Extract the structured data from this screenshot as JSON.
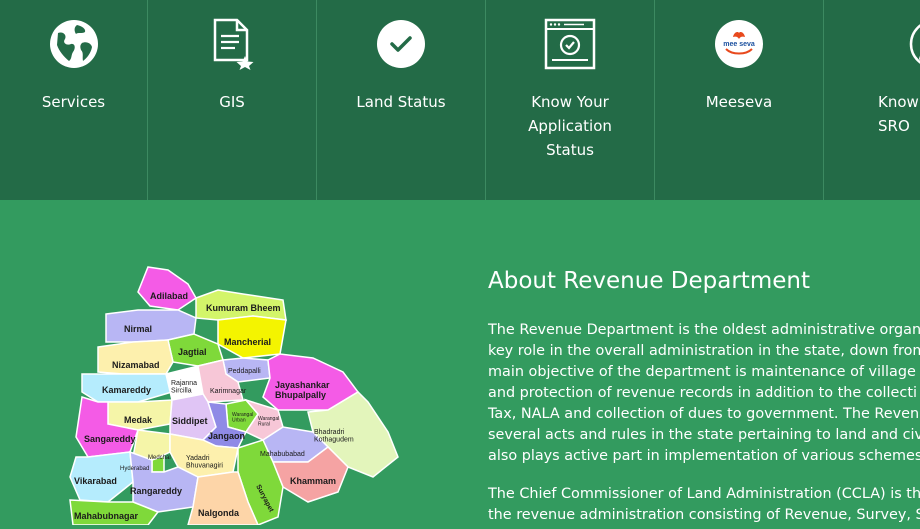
{
  "nav": {
    "items": [
      {
        "label": "Services",
        "icon": "globe-icon"
      },
      {
        "label": "GIS",
        "icon": "document-star-icon"
      },
      {
        "label": "Land Status",
        "icon": "check-circle-icon"
      },
      {
        "label": "Know Your\nApplication\nStatus",
        "icon": "browser-check-icon"
      },
      {
        "label": "Meeseva",
        "icon": "meeseva-logo"
      },
      {
        "label": "Know Y\nSRO",
        "icon": "user-circle-icon"
      }
    ]
  },
  "meeseva_logo_text": "mee seva",
  "about": {
    "title": "About Revenue Department",
    "paragraph1": [
      "The Revenue Department is the oldest administrative organ o",
      "key role in the overall administration in the state, down from",
      "main objective of the department is maintenance of village",
      "and protection of revenue records in addition to the collecti",
      "Tax, NALA and collection of dues to government. The Revenu",
      "several acts and rules in the state pertaining to land and civil",
      "also plays active part in implementation of various schemes o"
    ],
    "paragraph2": [
      "The Chief Commissioner of Land Administration (CCLA) is th",
      "the revenue administration consisting of Revenue, Survey, S"
    ]
  },
  "map": {
    "districts": {
      "adilabad": "Adilabad",
      "kumuram_bheem": "Kumuram Bheem",
      "nirmal": "Nirmal",
      "mancherial": "Mancherial",
      "jagtial": "Jagtial",
      "nizamabad": "Nizamabad",
      "peddapalli": "Peddapalli",
      "jayashankar": "Jayashankar\nBhupalpally",
      "kamareddy": "Kamareddy",
      "rajanna": "Rajanna\nSircilla",
      "karimnagar": "Karimnagar",
      "medak": "Medak",
      "siddipet": "Siddipet",
      "warangal_urban": "Warangal\nUrban",
      "warangal_rural": "Warangal\nRural",
      "bhadradri": "Bhadradri\nKothagudem",
      "sangareddy": "Sangareddy",
      "jangaon": "Jangaon",
      "mahabubabad": "Mahabubabad",
      "medchal": "Medchal",
      "hyderabad": "Hyderabad",
      "yadadri": "Yadadri\nBhuvanagiri",
      "vikarabad": "Vikarabad",
      "khammam": "Khammam",
      "rangareddy": "Rangareddy",
      "suryapet": "Suryapet",
      "mahabubnagar": "Mahabubnagar",
      "nalgonda": "Nalgonda"
    }
  }
}
